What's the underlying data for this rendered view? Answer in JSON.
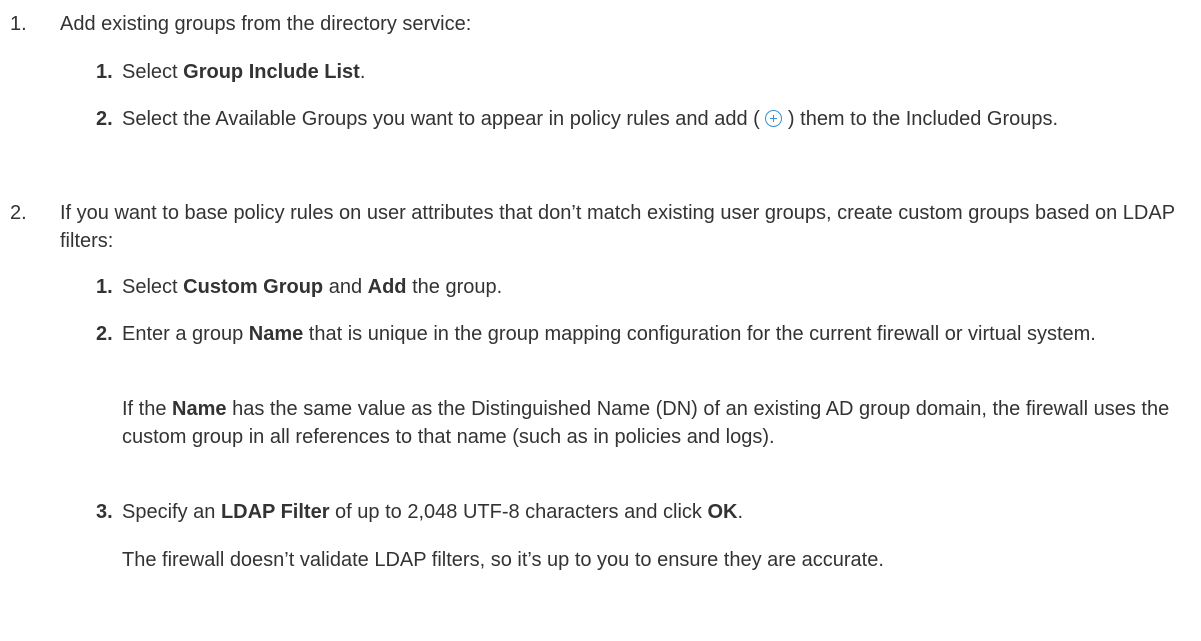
{
  "steps": [
    {
      "number": "1.",
      "text": "Add existing groups from the directory service:",
      "substeps": [
        {
          "number": "1.",
          "pre": "Select ",
          "bold": "Group Include List",
          "post": "."
        },
        {
          "number": "2.",
          "pre": "Select the Available Groups you want to appear in policy rules and add ( ",
          "icon": "add-circle-icon",
          "post": " ) them to the Included Groups."
        }
      ]
    },
    {
      "number": "2.",
      "text": "If you want to base policy rules on user attributes that don’t match existing user groups, create custom groups based on LDAP filters:",
      "substeps": [
        {
          "number": "1.",
          "pre": "Select ",
          "bold1": "Custom Group",
          "mid": " and ",
          "bold2": "Add",
          "post": " the group."
        },
        {
          "number": "2.",
          "pre": "Enter a group ",
          "bold": "Name",
          "post": " that is unique in the group mapping configuration for the current firewall or virtual system.",
          "note_pre": "If the ",
          "note_bold": "Name",
          "note_post": " has the same value as the Distinguished Name (DN) of an existing AD group domain, the firewall uses the custom group in all references to that name (such as in policies and logs)."
        },
        {
          "number": "3.",
          "pre": "Specify an ",
          "bold1": "LDAP Filter",
          "mid": " of up to 2,048 UTF-8 characters and click ",
          "bold2": "OK",
          "post": ".",
          "note": "The firewall doesn’t validate LDAP filters, so it’s up to you to ensure they are accurate."
        }
      ]
    }
  ]
}
